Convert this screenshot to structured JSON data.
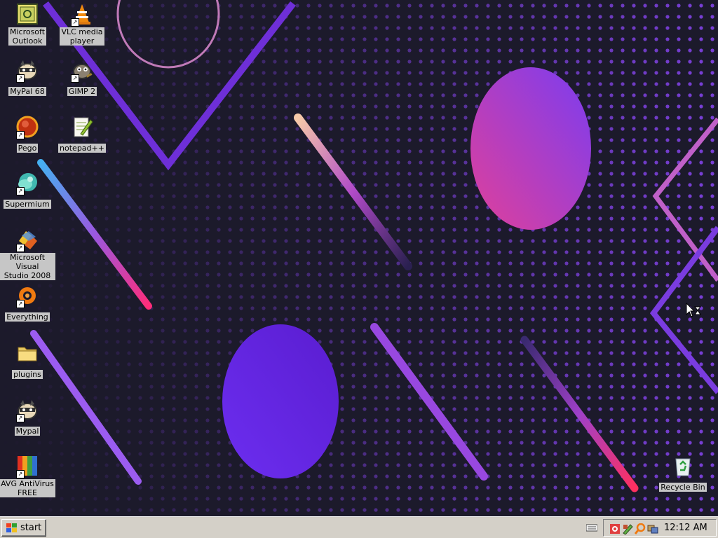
{
  "desktop": {
    "icons": [
      {
        "id": "outlook",
        "label": "Microsoft\nOutlook",
        "icon": "outlook-icon"
      },
      {
        "id": "vlc",
        "label": "VLC media\nplayer",
        "icon": "vlc-cone-icon"
      },
      {
        "id": "mypal68",
        "label": "MyPal 68",
        "icon": "raccoon-icon"
      },
      {
        "id": "gimp",
        "label": "GIMP 2",
        "icon": "gimp-icon"
      },
      {
        "id": "pego",
        "label": "Pego",
        "icon": "pego-icon"
      },
      {
        "id": "notepadpp",
        "label": "notepad++",
        "icon": "notepad-icon"
      },
      {
        "id": "supermium",
        "label": "Supermium",
        "icon": "supermium-icon"
      },
      {
        "id": "vs2008",
        "label": "Microsoft Visual\nStudio 2008",
        "icon": "visual-studio-icon"
      },
      {
        "id": "everything",
        "label": "Everything",
        "icon": "search-icon"
      },
      {
        "id": "plugins",
        "label": "plugins",
        "icon": "folder-icon"
      },
      {
        "id": "mypal",
        "label": "Mypal",
        "icon": "raccoon-icon"
      },
      {
        "id": "avg",
        "label": "AVG AntiVirus\nFREE",
        "icon": "avg-icon"
      },
      {
        "id": "recycle",
        "label": "Recycle Bin",
        "icon": "recycle-bin-icon"
      }
    ]
  },
  "taskbar": {
    "start_label": "start",
    "clock": "12:12 AM",
    "tray_icons": [
      "shield-icon",
      "pencil-icon",
      "search-icon",
      "network-icon"
    ]
  },
  "colors": {
    "wallpaper_bg": "#1c1a2b",
    "taskbar_bg": "#d4d0c8",
    "purple": "#8a3df0",
    "pink": "#ff2d7a",
    "violet": "#6a2ee8"
  }
}
